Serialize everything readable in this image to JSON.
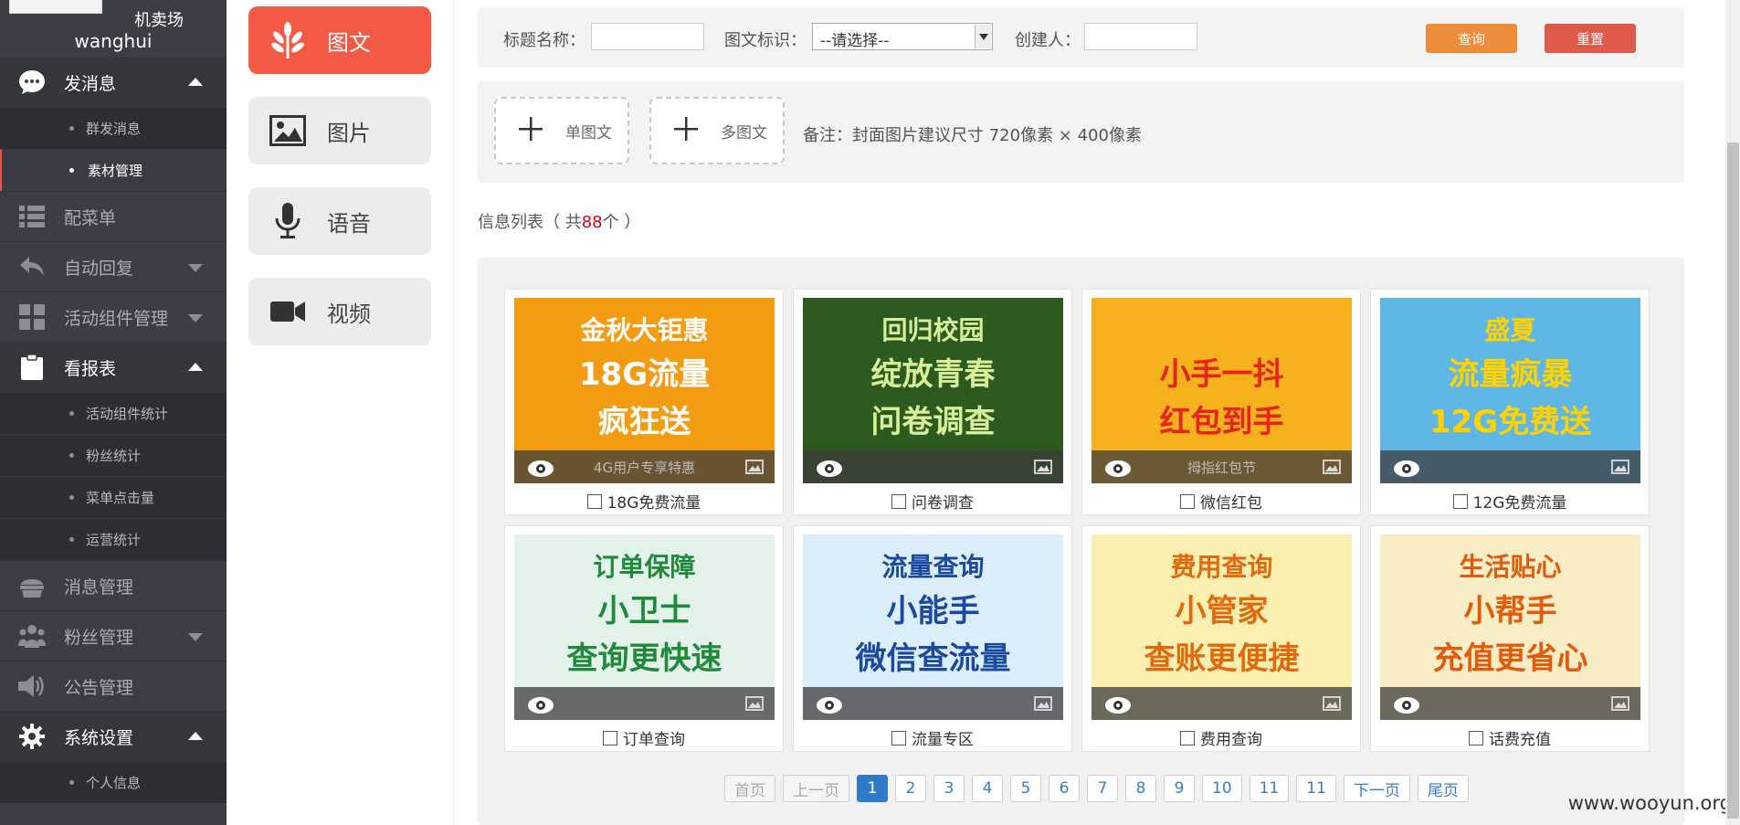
{
  "sidebar": {
    "shop_name": "机卖场",
    "username": "wanghui",
    "menu": [
      {
        "label": "发消息",
        "icon": "chat-bubble-icon",
        "arrow": "up",
        "sub": [
          {
            "label": "群发消息"
          },
          {
            "label": "素材管理"
          }
        ]
      },
      {
        "label": "配菜单",
        "icon": "list-icon"
      },
      {
        "label": "自动回复",
        "icon": "reply-icon",
        "arrow": "down"
      },
      {
        "label": "活动组件管理",
        "icon": "grid-icon",
        "arrow": "down"
      },
      {
        "label": "看报表",
        "icon": "clipboard-icon",
        "arrow": "up",
        "sub": [
          {
            "label": "活动组件统计"
          },
          {
            "label": "粉丝统计"
          },
          {
            "label": "菜单点击量"
          },
          {
            "label": "运营统计"
          }
        ]
      },
      {
        "label": "消息管理",
        "icon": "cake-icon"
      },
      {
        "label": "粉丝管理",
        "icon": "users-icon",
        "arrow": "down"
      },
      {
        "label": "公告管理",
        "icon": "speaker-icon"
      },
      {
        "label": "系统设置",
        "icon": "gear-icon",
        "arrow": "up",
        "sub": [
          {
            "label": "个人信息"
          }
        ]
      }
    ]
  },
  "type_tabs": [
    {
      "label": "图文",
      "icon": "leaf-icon",
      "active": true
    },
    {
      "label": "图片",
      "icon": "image-icon",
      "active": false
    },
    {
      "label": "语音",
      "icon": "microphone-icon",
      "active": false
    },
    {
      "label": "视频",
      "icon": "video-camera-icon",
      "active": false
    }
  ],
  "filter": {
    "title_label": "标题名称：",
    "title_value": "",
    "tag_label": "图文标识：",
    "tag_selected": "--请选择--",
    "creator_label": "创建人：",
    "creator_value": "",
    "search_button": "查询",
    "reset_button": "重置"
  },
  "upload": {
    "single_label": "单图文",
    "multi_label": "多图文",
    "note": "备注：封面图片建议尺寸 720像素 × 400像素"
  },
  "list": {
    "title_prefix": "信息列表（ 共",
    "count": "88",
    "title_suffix": "个 ）",
    "items": [
      {
        "title": "18G免费流量",
        "line1": "金秋大钜惠",
        "line2": "18G流量",
        "line3": "疯狂送",
        "band": "4G用户专享特惠",
        "bg": "#f39c12",
        "fg": "#fff"
      },
      {
        "title": "问卷调查",
        "line1": "回归校园",
        "line2": "绽放青春",
        "line3": "问卷调查",
        "band": "",
        "bg": "#2d5a1e",
        "fg": "#d8ef9a"
      },
      {
        "title": "微信红包",
        "line1": "",
        "line2": "小手一抖",
        "line3": "红包到手",
        "band": "拇指红包节",
        "bg": "#f5b21c",
        "fg": "#e8231c"
      },
      {
        "title": "12G免费流量",
        "line1": "盛夏",
        "line2": "流量疯暴",
        "line3": "12G免费送",
        "band": "",
        "bg": "#5fb7e6",
        "fg": "#ffd200"
      },
      {
        "title": "订单查询",
        "line1": "订单保障",
        "line2": "小卫士",
        "line3": "查询更快速",
        "band": "",
        "bg": "#e4f3ea",
        "fg": "#1e8a3a"
      },
      {
        "title": "流量专区",
        "line1": "流量查询",
        "line2": "小能手",
        "line3": "微信查流量",
        "band": "",
        "bg": "#dceefa",
        "fg": "#1a4aa0"
      },
      {
        "title": "费用查询",
        "line1": "费用查询",
        "line2": "小管家",
        "line3": "查账更便捷",
        "band": "",
        "bg": "#f8efb0",
        "fg": "#e36a0c"
      },
      {
        "title": "话费充值",
        "line1": "生活贴心",
        "line2": "小帮手",
        "line3": "充值更省心",
        "band": "",
        "bg": "#f8edc4",
        "fg": "#e35a0c"
      }
    ]
  },
  "pagination": {
    "items": [
      {
        "label": "首页",
        "state": "disabled"
      },
      {
        "label": "上一页",
        "state": "disabled"
      },
      {
        "label": "1",
        "state": "current"
      },
      {
        "label": "2",
        "state": ""
      },
      {
        "label": "3",
        "state": ""
      },
      {
        "label": "4",
        "state": ""
      },
      {
        "label": "5",
        "state": ""
      },
      {
        "label": "6",
        "state": ""
      },
      {
        "label": "7",
        "state": ""
      },
      {
        "label": "8",
        "state": ""
      },
      {
        "label": "9",
        "state": ""
      },
      {
        "label": "10",
        "state": ""
      },
      {
        "label": "11",
        "state": ""
      },
      {
        "label": "11",
        "state": ""
      },
      {
        "label": "下一页",
        "state": ""
      },
      {
        "label": "尾页",
        "state": ""
      }
    ]
  },
  "watermark": "www.wooyun.org",
  "colors": {
    "accent": "#f25a45",
    "sidebar_bg": "#3b3f45",
    "search_btn": "#ef8c3a",
    "reset_btn": "#e05a4b",
    "page_current": "#2f7bc8"
  }
}
